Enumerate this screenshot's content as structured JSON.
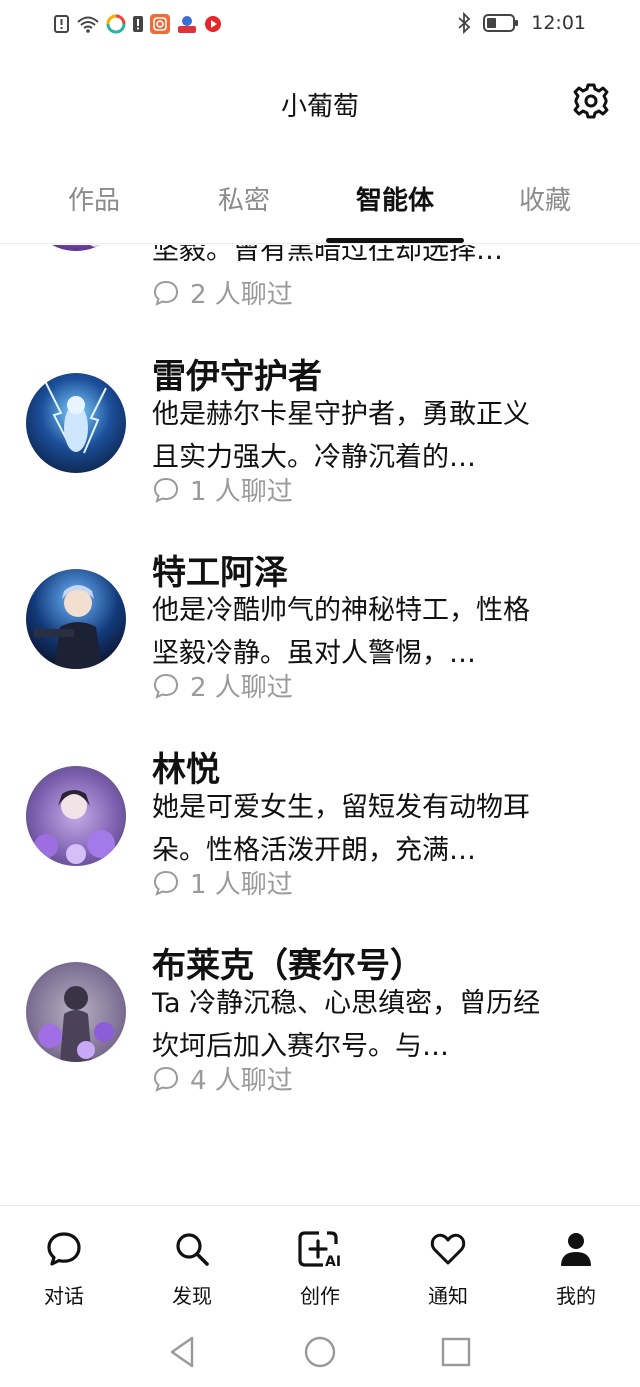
{
  "status_bar": {
    "time": "12:01",
    "icons": [
      "alert-icon",
      "wifi-icon",
      "app-icon",
      "battery-warning-icon",
      "instagram-icon",
      "app-icon",
      "play-icon",
      "bluetooth-icon",
      "battery-icon"
    ]
  },
  "header": {
    "title": "小葡萄",
    "settings_icon": "gear-icon"
  },
  "tabs": [
    {
      "label": "作品",
      "active": false
    },
    {
      "label": "私密",
      "active": false
    },
    {
      "label": "智能体",
      "active": true
    },
    {
      "label": "收藏",
      "active": false
    }
  ],
  "agents": [
    {
      "name": "",
      "desc": "坚毅。曾有黑暗过往却选择…",
      "chats": "2 人聊过"
    },
    {
      "name": "雷伊守护者",
      "desc": "他是赫尔卡星守护者，勇敢正义且实力强大。冷静沉着的…",
      "chats": "1 人聊过"
    },
    {
      "name": "特工阿泽",
      "desc": "他是冷酷帅气的神秘特工，性格坚毅冷静。虽对人警惕，…",
      "chats": "2 人聊过"
    },
    {
      "name": "林悦",
      "desc": "她是可爱女生，留短发有动物耳朵。性格活泼开朗，充满…",
      "chats": "1 人聊过"
    },
    {
      "name": "布莱克（赛尔号）",
      "desc": "Ta 冷静沉稳、心思缜密，曾历经坎坷后加入赛尔号。与…",
      "chats": "4 人聊过"
    }
  ],
  "bottom_nav": [
    {
      "label": "对话",
      "icon": "chat-bubble-icon"
    },
    {
      "label": "发现",
      "icon": "search-icon"
    },
    {
      "label": "创作",
      "icon": "ai-create-icon"
    },
    {
      "label": "通知",
      "icon": "heart-icon"
    },
    {
      "label": "我的",
      "icon": "profile-icon"
    }
  ],
  "colors": {
    "accent": "#111111",
    "muted": "#9a9a9a"
  }
}
